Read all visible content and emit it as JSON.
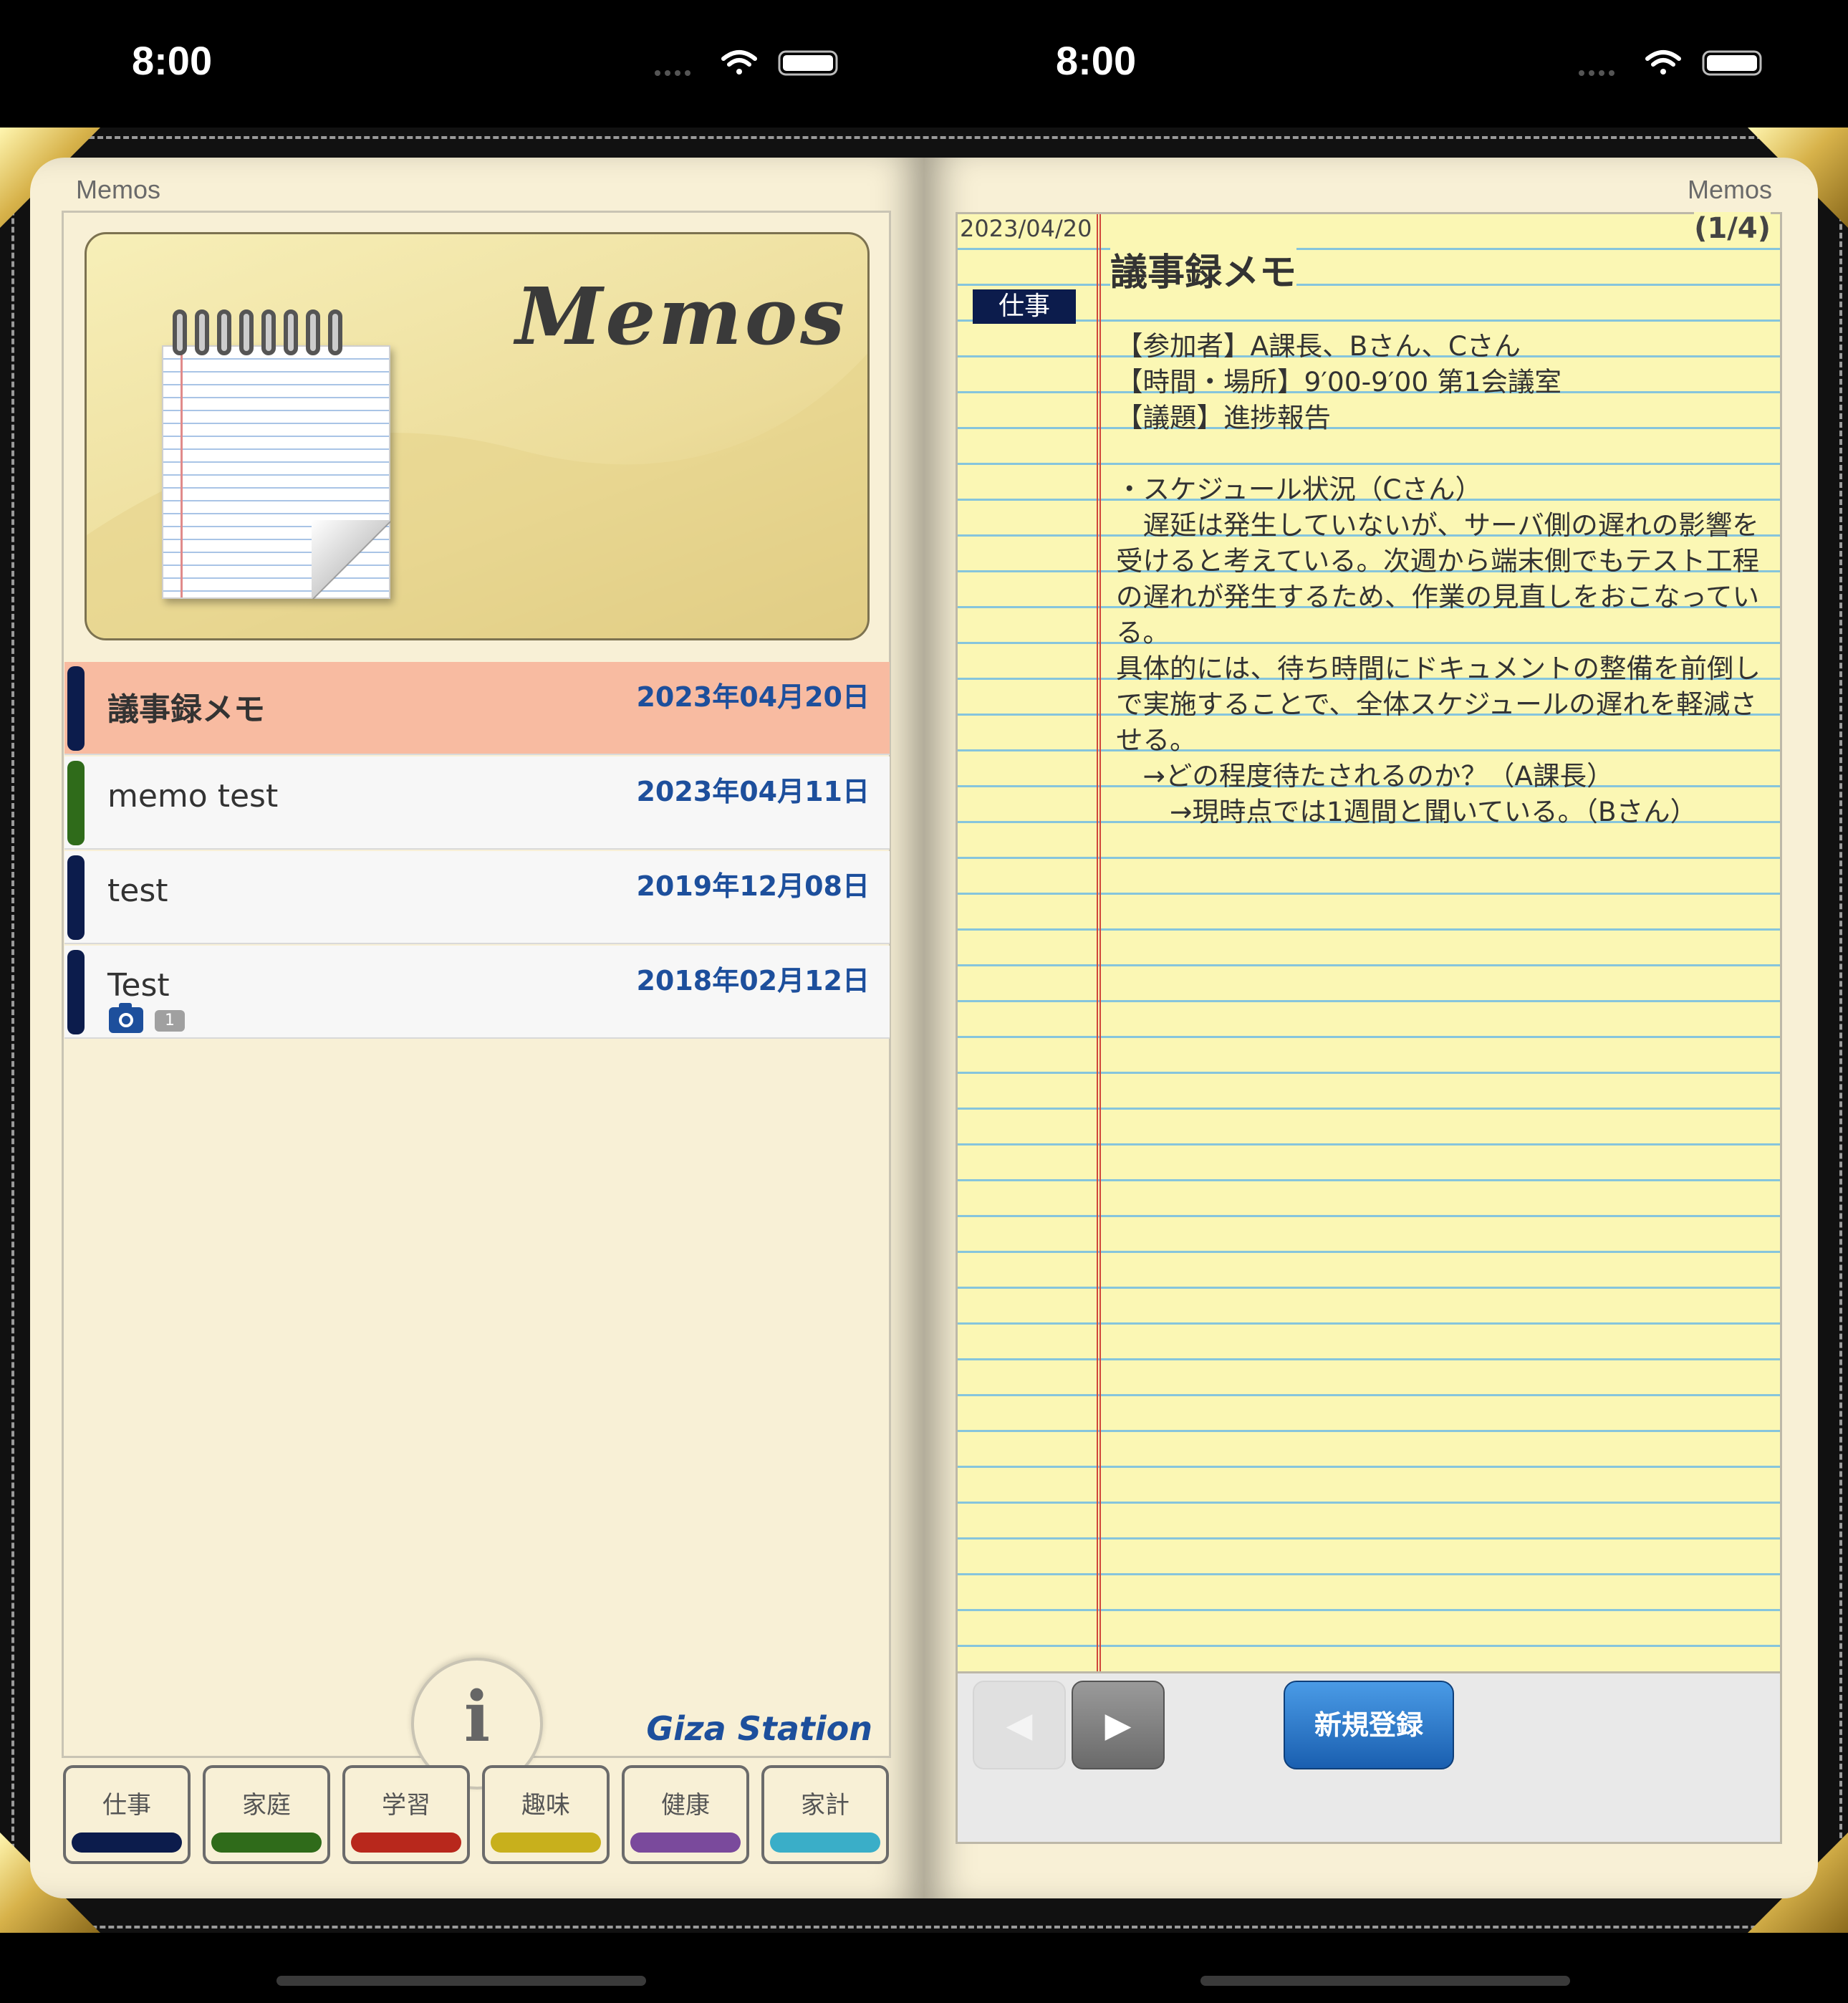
{
  "status_bar": {
    "left_time": "8:00",
    "right_time": "8:00"
  },
  "left_page": {
    "header": "Memos",
    "banner_title": "Memos",
    "memos": [
      {
        "title": "議事録メモ",
        "date": "2023年04月20日",
        "color": "#0c1c4c",
        "selected": true
      },
      {
        "title": "memo test",
        "date": "2023年04月11日",
        "color": "#2f6b1a",
        "selected": false
      },
      {
        "title": "test",
        "date": "2019年12月08日",
        "color": "#0c1c4c",
        "selected": false
      },
      {
        "title": "Test",
        "date": "2018年02月12日",
        "color": "#0c1c4c",
        "selected": false,
        "photo_count": "1"
      }
    ],
    "info_icon": "i",
    "brand": "Giza Station",
    "categories": [
      {
        "label": "仕事",
        "color": "#0c1c4c"
      },
      {
        "label": "家庭",
        "color": "#2f6b1a"
      },
      {
        "label": "学習",
        "color": "#b8281c"
      },
      {
        "label": "趣味",
        "color": "#c8b01c"
      },
      {
        "label": "健康",
        "color": "#7a4a9c"
      },
      {
        "label": "家計",
        "color": "#3aaec8"
      }
    ]
  },
  "right_page": {
    "header": "Memos",
    "date": "2023/04/20",
    "page_indicator": "(1/4)",
    "title": "議事録メモ",
    "category_tag": "仕事",
    "body": "【参加者】A課長、Bさん、Cさん\n【時間・場所】9′00-9′00 第1会議室\n【議題】進捗報告\n\n・スケジュール状況（Cさん）\n　遅延は発生していないが、サーバ側の遅れの影響を受けると考えている。次週から端末側でもテスト工程の遅れが発生するため、作業の見直しをおこなっている。\n具体的には、待ち時間にドキュメントの整備を前倒しで実施することで、全体スケジュールの遅れを軽減させる。\n　→どの程度待たされるのか？（A課長）\n　　→現時点では1週間と聞いている。（Bさん）",
    "prev_glyph": "◀",
    "next_glyph": "▶",
    "new_button": "新規登録"
  }
}
